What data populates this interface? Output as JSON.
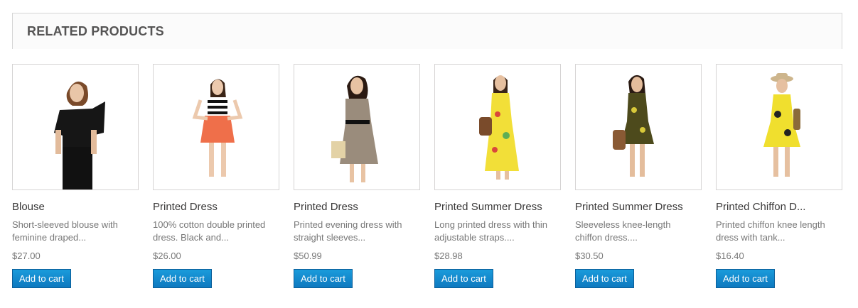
{
  "section": {
    "title": "RELATED PRODUCTS"
  },
  "products": [
    {
      "name": "Blouse",
      "description": "Short-sleeved blouse with feminine draped...",
      "price": "$27.00",
      "cart_label": "Add to cart",
      "image": "model-black-blouse"
    },
    {
      "name": "Printed Dress",
      "description": "100% cotton double printed dress. Black and...",
      "price": "$26.00",
      "cart_label": "Add to cart",
      "image": "model-striped-top-orange-skirt"
    },
    {
      "name": "Printed Dress",
      "description": "Printed evening dress with straight sleeves...",
      "price": "$50.99",
      "cart_label": "Add to cart",
      "image": "model-printed-evening-dress"
    },
    {
      "name": "Printed Summer Dress",
      "description": "Long printed dress with thin adjustable straps....",
      "price": "$28.98",
      "cart_label": "Add to cart",
      "image": "model-long-yellow-dress"
    },
    {
      "name": "Printed Summer Dress",
      "description": "Sleeveless knee-length chiffon dress....",
      "price": "$30.50",
      "cart_label": "Add to cart",
      "image": "model-olive-chiffon-dress"
    },
    {
      "name": "Printed Chiffon D...",
      "description": "Printed chiffon knee length dress with tank...",
      "price": "$16.40",
      "cart_label": "Add to cart",
      "image": "model-yellow-chiffon-dress-hat"
    }
  ],
  "colors": {
    "button": "#0f83cc",
    "button_border": "#0b5e99",
    "header_bg": "#fbfbfb"
  }
}
